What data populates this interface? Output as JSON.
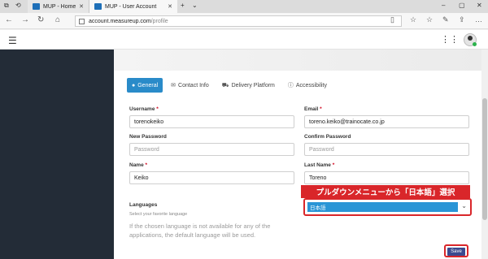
{
  "browser": {
    "tabs": [
      {
        "label": "MUP - Home"
      },
      {
        "label": "MUP - User Account"
      }
    ],
    "url_host": "account.measureup.com",
    "url_path": "/profile"
  },
  "profile_tabs": [
    {
      "label": "General",
      "icon": "user-icon",
      "active": true
    },
    {
      "label": "Contact Info",
      "icon": "envelope-icon",
      "active": false
    },
    {
      "label": "Delivery Platform",
      "icon": "truck-icon",
      "active": false
    },
    {
      "label": "Accessibility",
      "icon": "info-icon",
      "active": false
    }
  ],
  "form": {
    "username": {
      "label": "Username",
      "value": "torenokeiko"
    },
    "email": {
      "label": "Email",
      "value": "toreno.keiko@trainocate.co.jp"
    },
    "new_password": {
      "label": "New Password",
      "placeholder": "Password"
    },
    "confirm_password": {
      "label": "Confirm Password",
      "placeholder": "Password"
    },
    "first_name": {
      "label": "Name",
      "value": "Keiko"
    },
    "last_name": {
      "label": "Last Name",
      "value": "Toreno"
    },
    "required_mark": "*"
  },
  "languages": {
    "label": "Languages",
    "subtitle": "Select your favorite language",
    "note": "If the chosen language is not available for any of the applications, the default language will be used.",
    "selected": "日本語"
  },
  "callout": {
    "text": "プルダウンメニューから「日本語」選択",
    "color": "#d9262a"
  },
  "save_label": "Save",
  "colors": {
    "accent": "#2a8bc9",
    "sidebar": "#232c37",
    "save_button": "#3b4a8f"
  }
}
